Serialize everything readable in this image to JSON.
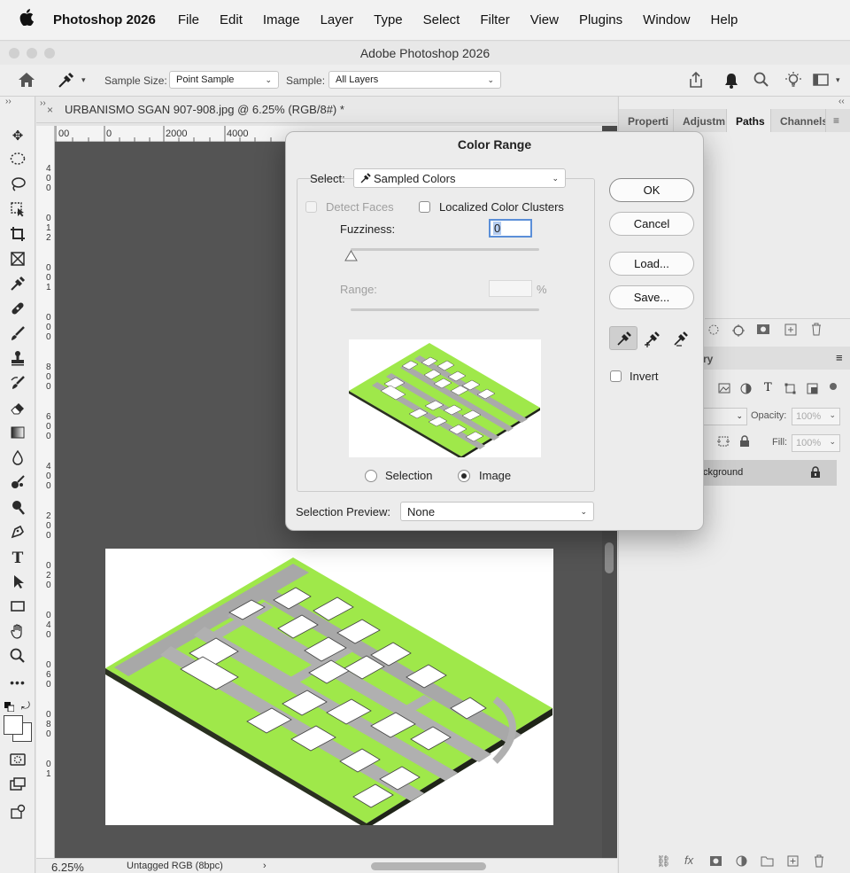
{
  "menubar": {
    "app": "Photoshop 2026",
    "items": [
      "File",
      "Edit",
      "Image",
      "Layer",
      "Type",
      "Select",
      "Filter",
      "View",
      "Plugins",
      "Window",
      "Help"
    ]
  },
  "window": {
    "title": "Adobe Photoshop 2026"
  },
  "options": {
    "sample_size_label": "Sample Size:",
    "sample_size_value": "Point Sample",
    "sample_label": "Sample:",
    "sample_value": "All Layers"
  },
  "document": {
    "tab_title": "URBANISMO SGAN 907-908.jpg @ 6.25% (RGB/8#) *",
    "zoom": "6.25%",
    "color_profile": "Untagged RGB (8bpc)",
    "hruler_labels": [
      "00",
      "0",
      "2000",
      "4000"
    ],
    "vruler_labels": [
      "4",
      "0",
      "0",
      "0",
      "1",
      "2",
      "0",
      "0",
      "1",
      "0",
      "0",
      "0",
      "8",
      "0",
      "0",
      "6",
      "0",
      "0",
      "4",
      "0",
      "0",
      "2",
      "0",
      "0",
      "0",
      "2",
      "0",
      "0",
      "4",
      "0",
      "0",
      "6",
      "0",
      "0",
      "8",
      "0",
      "0",
      "1"
    ]
  },
  "panels": {
    "tabs": [
      "Properti",
      "Adjustm",
      "Paths",
      "Channels"
    ],
    "layers_tab_partial": "ry",
    "opacity_label": "Opacity:",
    "opacity_value": "100%",
    "fill_label": "Fill:",
    "fill_value": "100%",
    "layer_name": "ckground"
  },
  "dialog": {
    "title": "Color Range",
    "select_label": "Select:",
    "select_value": "Sampled Colors",
    "detect_faces": "Detect Faces",
    "localized": "Localized Color Clusters",
    "fuzziness_label": "Fuzziness:",
    "fuzziness_value": "0",
    "fuzziness_fraction": 0.0,
    "range_label": "Range:",
    "range_unit": "%",
    "preview_selection": "Selection",
    "preview_image": "Image",
    "selection_preview_label": "Selection Preview:",
    "selection_preview_value": "None",
    "ok": "OK",
    "cancel": "Cancel",
    "load": "Load...",
    "save": "Save...",
    "invert": "Invert"
  },
  "colors": {
    "site_green": "#9fe84a",
    "canvas_bg": "#545454"
  }
}
